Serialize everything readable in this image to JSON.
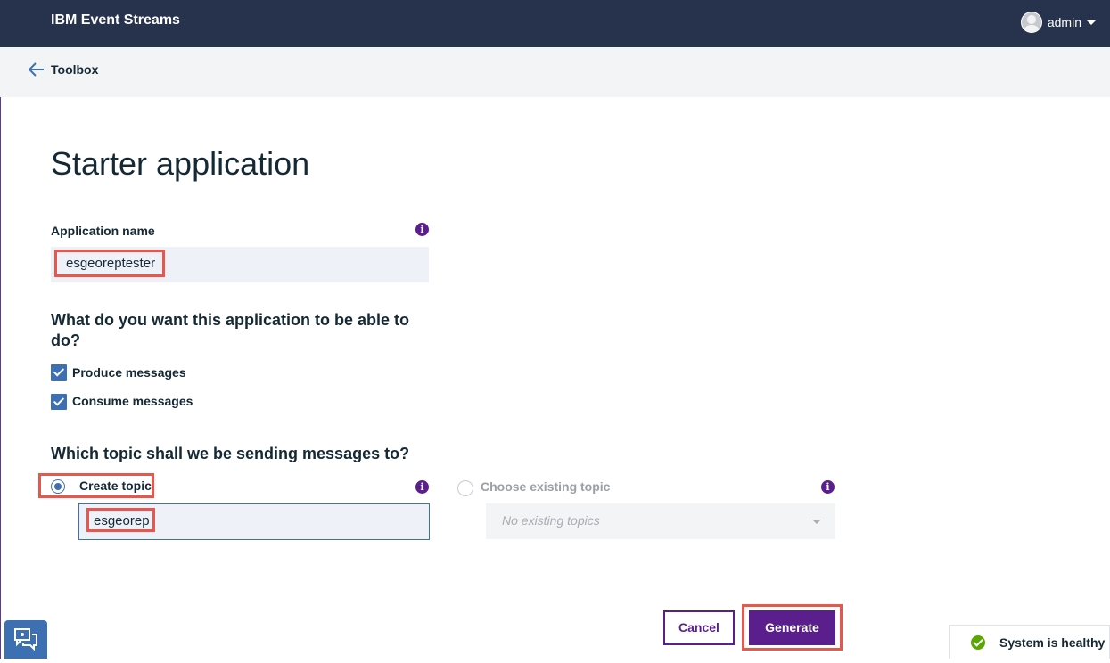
{
  "header": {
    "brand": "IBM Event Streams",
    "user": "admin"
  },
  "breadcrumb": {
    "back_label": "Toolbox"
  },
  "page": {
    "title": "Starter application"
  },
  "app_name": {
    "label": "Application name",
    "value": "esgeoreptester"
  },
  "capabilities": {
    "question": "What do you want this application to be able to do?",
    "options": [
      {
        "label": "Produce messages",
        "checked": true
      },
      {
        "label": "Consume messages",
        "checked": true
      }
    ]
  },
  "topic": {
    "question": "Which topic shall we be sending messages to?",
    "create_label": "Create topic",
    "create_selected": true,
    "create_value": "esgeorep",
    "existing_label": "Choose existing topic",
    "existing_placeholder": "No existing topics"
  },
  "actions": {
    "cancel": "Cancel",
    "generate": "Generate"
  },
  "status": {
    "text": "System is healthy",
    "color": "#5aa700"
  },
  "colors": {
    "header_bg": "#27324d",
    "accent_purple": "#5a1f8c",
    "checkbox_blue": "#3d70b2",
    "highlight_red": "#e8574c"
  },
  "icons": {
    "back": "arrow-left-icon",
    "info": "info-icon",
    "user": "user-avatar-icon",
    "chat": "chat-icon",
    "status": "check-circle-icon"
  }
}
